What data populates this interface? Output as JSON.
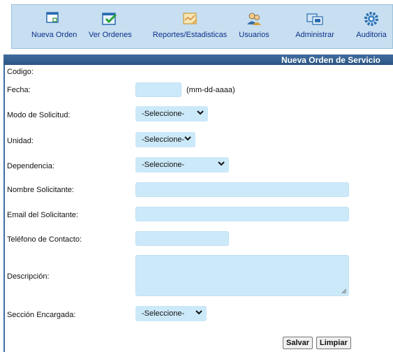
{
  "toolbar": {
    "items": [
      {
        "label": "Nueva Orden",
        "icon": "new-order-icon"
      },
      {
        "label": "Ver Ordenes",
        "icon": "view-orders-icon"
      },
      {
        "label": "Reportes/Estadisticas",
        "icon": "reports-icon"
      },
      {
        "label": "Usuarios",
        "icon": "users-icon"
      },
      {
        "label": "Administrar",
        "icon": "admin-icon"
      },
      {
        "label": "Auditoria",
        "icon": "audit-gear-icon"
      }
    ]
  },
  "form": {
    "title": "Nueva Orden de Servicio",
    "codigo_label": "Codigo:",
    "fecha_label": "Fecha:",
    "fecha_hint": "(mm-dd-aaaa)",
    "modo_label": "Modo de Solicitud:",
    "modo_value": "-Seleccione-",
    "unidad_label": "Unidad:",
    "unidad_value": "-Seleccione-",
    "dependencia_label": "Dependencia:",
    "dependencia_value": "-Seleccione-",
    "nombre_label": "Nombre Solicitante:",
    "email_label": "Email del Solicitante:",
    "telefono_label": "Teléfono de Contacto:",
    "descripcion_label": "Descripción:",
    "seccion_label": "Sección Encargada:",
    "seccion_value": "-Seleccione-",
    "save_label": "Salvar",
    "clear_label": "Limpiar"
  },
  "colors": {
    "header": "#2c5482",
    "toolbar": "#c7dff0",
    "field": "#cce9f9"
  }
}
